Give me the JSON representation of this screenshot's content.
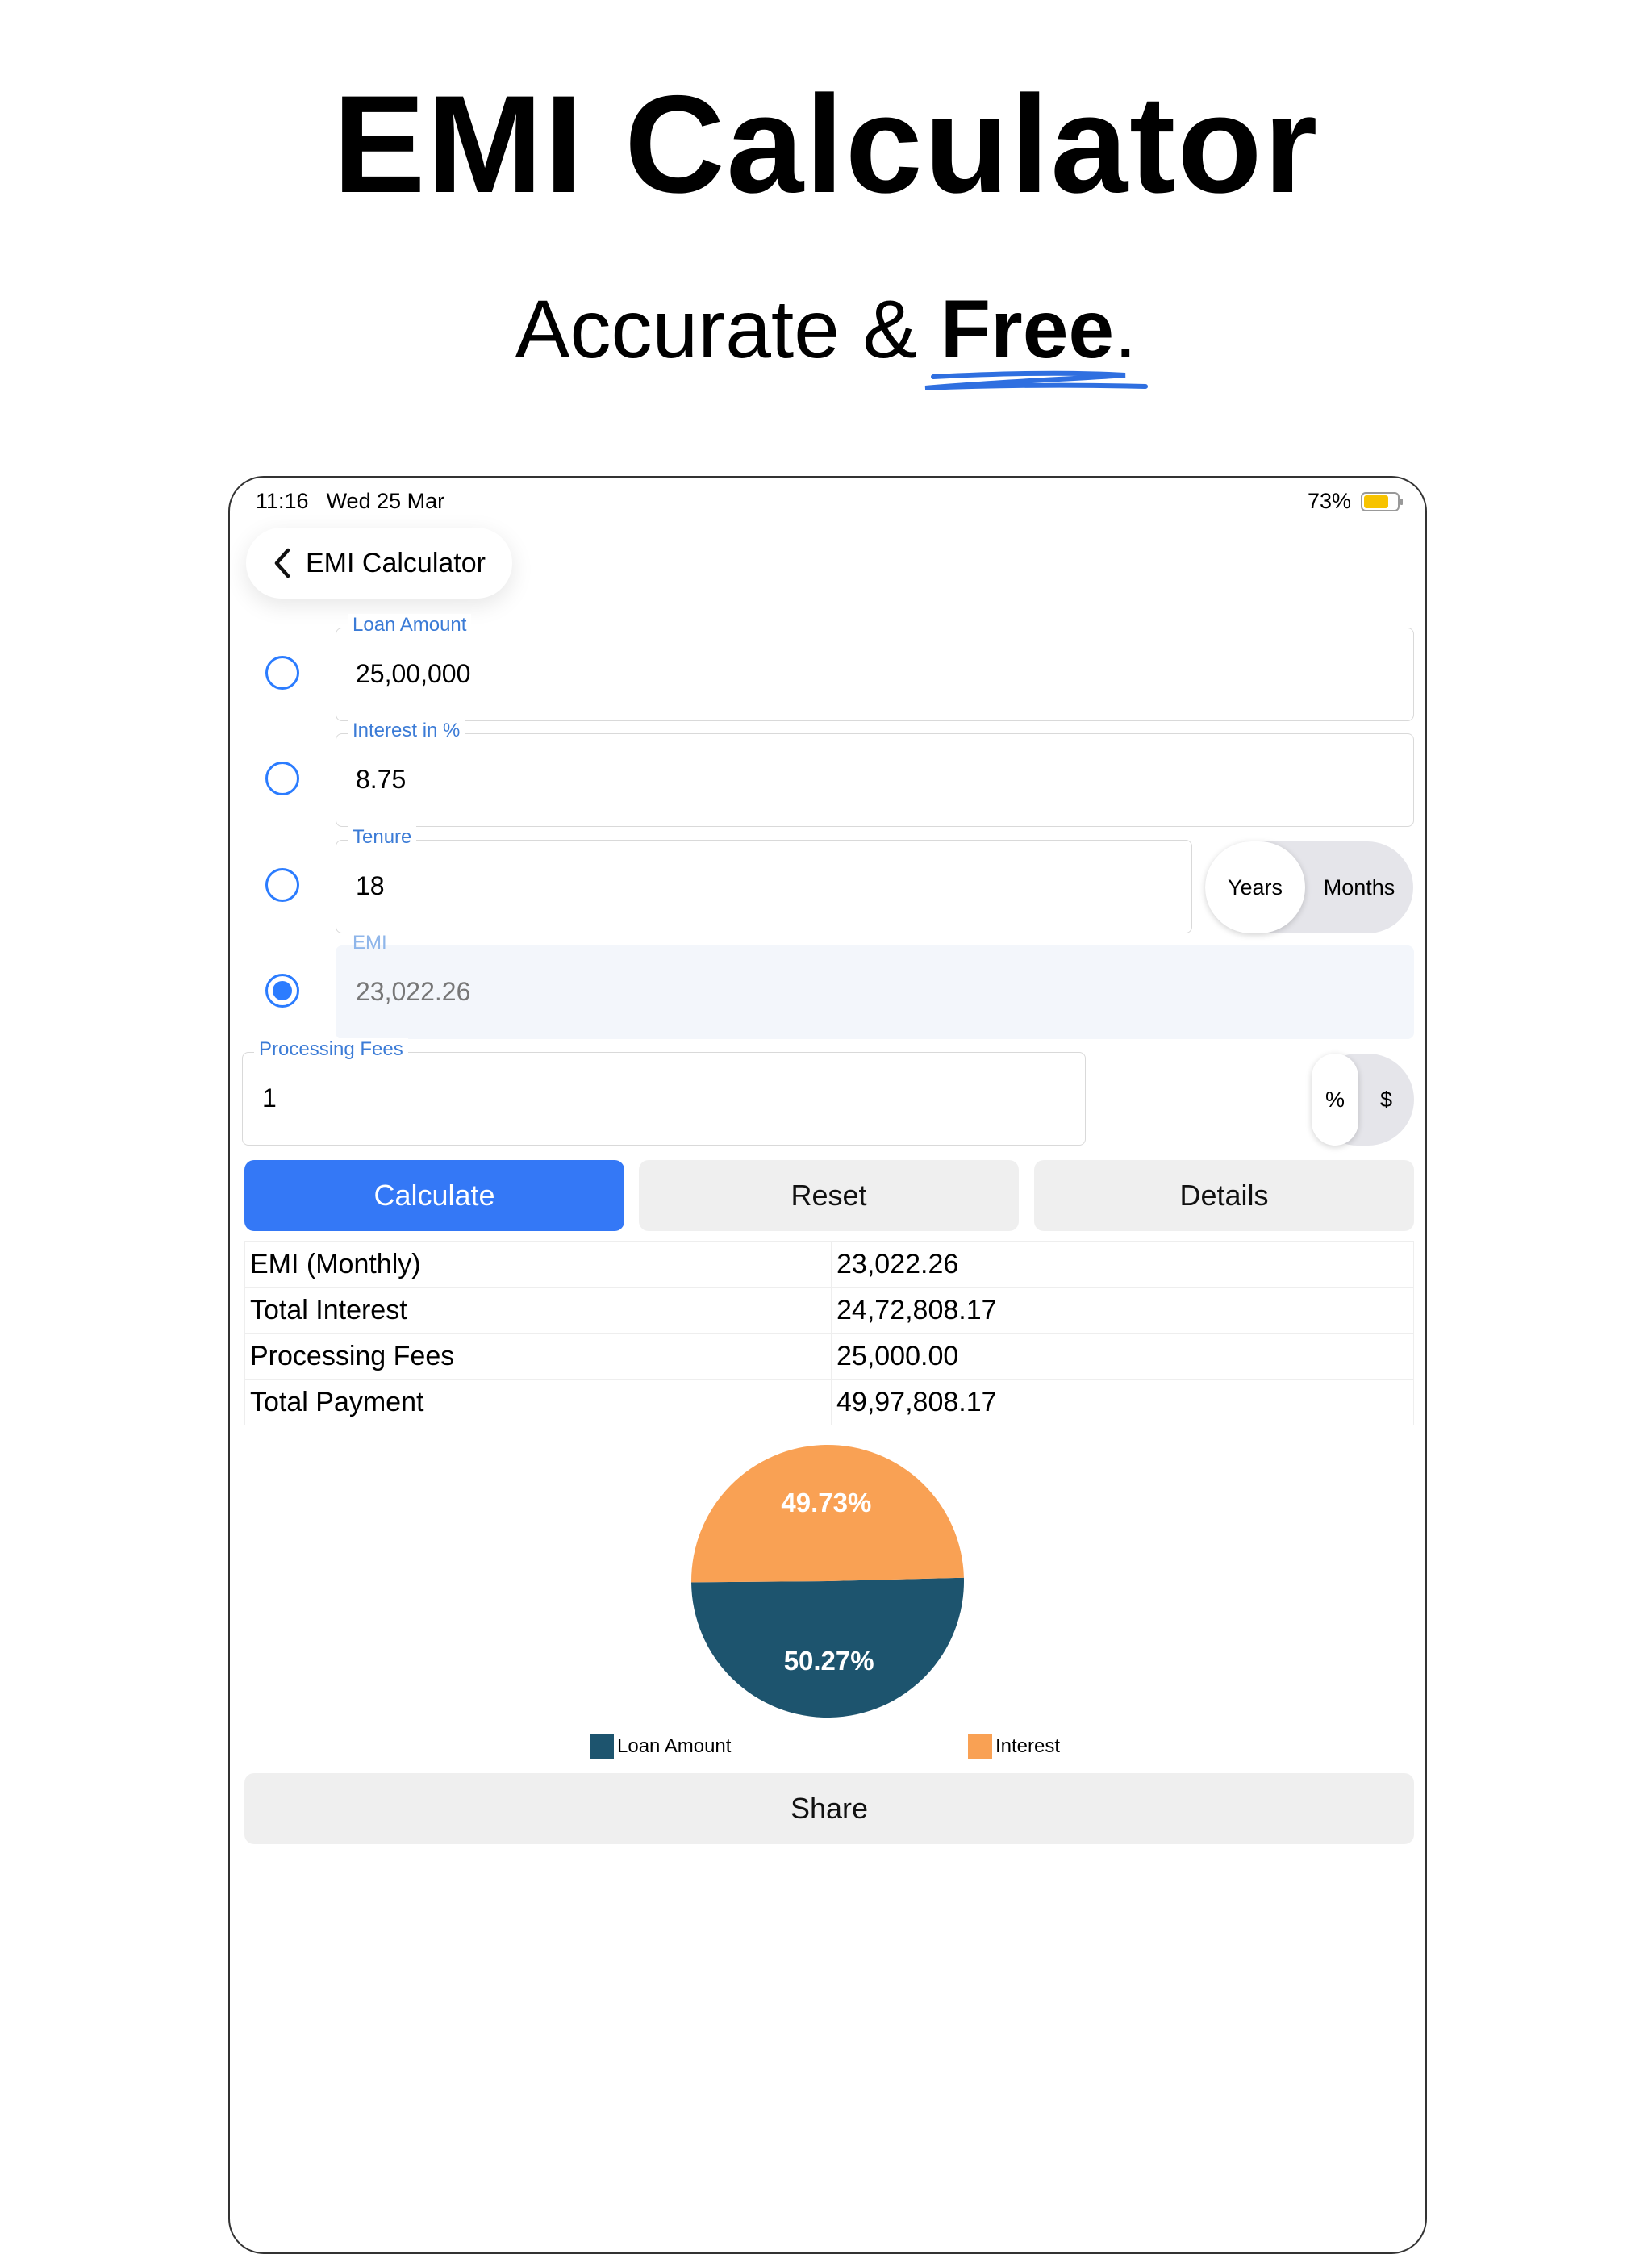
{
  "headline": "EMI Calculator",
  "tagline": {
    "prefix": "Accurate & ",
    "emphasis": "Free",
    "suffix": "."
  },
  "status_bar": {
    "time": "11:16",
    "date": "Wed 25 Mar",
    "battery": "73%"
  },
  "nav": {
    "title": "EMI Calculator",
    "back_icon": "chevron-left-icon"
  },
  "fields": {
    "loan_amount": {
      "label": "Loan Amount",
      "value": "25,00,000"
    },
    "interest": {
      "label": "Interest in %",
      "value": "8.75"
    },
    "tenure": {
      "label": "Tenure",
      "value": "18"
    },
    "emi": {
      "label": "EMI",
      "value": "23,022.26"
    },
    "processing_fees": {
      "label": "Processing Fees",
      "value": "1"
    }
  },
  "tenure_unit": {
    "options": [
      "Years",
      "Months"
    ],
    "selected": "Years"
  },
  "fee_unit": {
    "options": [
      "%",
      "$"
    ],
    "selected": "%"
  },
  "buttons": {
    "calculate": "Calculate",
    "reset": "Reset",
    "details": "Details",
    "share": "Share"
  },
  "results": [
    {
      "label": "EMI (Monthly)",
      "value": "23,022.26"
    },
    {
      "label": "Total Interest",
      "value": "24,72,808.17"
    },
    {
      "label": "Processing Fees",
      "value": "25,000.00"
    },
    {
      "label": "Total Payment",
      "value": "49,97,808.17"
    }
  ],
  "colors": {
    "accent": "#3478f6",
    "loan": "#1d546e",
    "interest": "#f9a154"
  },
  "chart_data": {
    "type": "pie",
    "slices": [
      {
        "name": "Loan Amount",
        "value": 50.27,
        "label": "50.27%",
        "color": "#1d546e"
      },
      {
        "name": "Interest",
        "value": 49.73,
        "label": "49.73%",
        "color": "#f9a154"
      }
    ],
    "legend": [
      "Loan Amount",
      "Interest"
    ]
  }
}
